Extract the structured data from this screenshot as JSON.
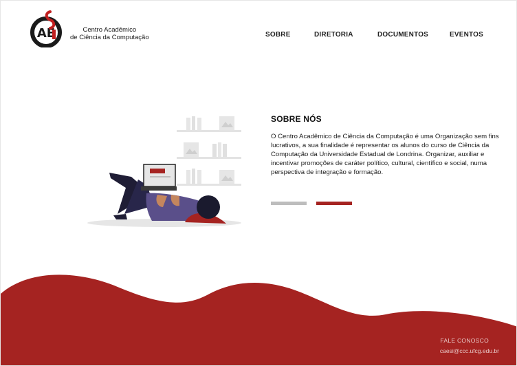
{
  "brand": {
    "logo_letters": "CAESI",
    "line1": "Centro Acadêmico",
    "line2": "de Ciência da Computação"
  },
  "nav": {
    "items": [
      "SOBRE",
      "DIRETORIA",
      "DOCUMENTOS",
      "EVENTOS"
    ]
  },
  "about": {
    "title": "SOBRE NÓS",
    "text": "O Centro Acadêmico de Ciência da Computação é uma Organização sem fins lucrativos, a sua finalidade é representar os alunos do curso de Ciência da Computação da Universidade Estadual de Londrina. Organizar, auxiliar e incentivar promoções de caráter político, cultural, científico e social, numa perspectiva de integração e formação."
  },
  "slider": {
    "count": 2,
    "active_index": 1
  },
  "footer": {
    "contact_title": "FALE CONOSCO",
    "email": "caesi@ccc.ufcg.edu.br"
  },
  "colors": {
    "accent": "#a52321",
    "inactive": "#bdbdbd",
    "dark": "#1a1a1a",
    "shelf": "#e3e3e3",
    "footer_text": "#e8c7c6"
  },
  "icons": {
    "logo": "caesi-logo-icon",
    "illustration": "person-with-laptop-illustration"
  }
}
